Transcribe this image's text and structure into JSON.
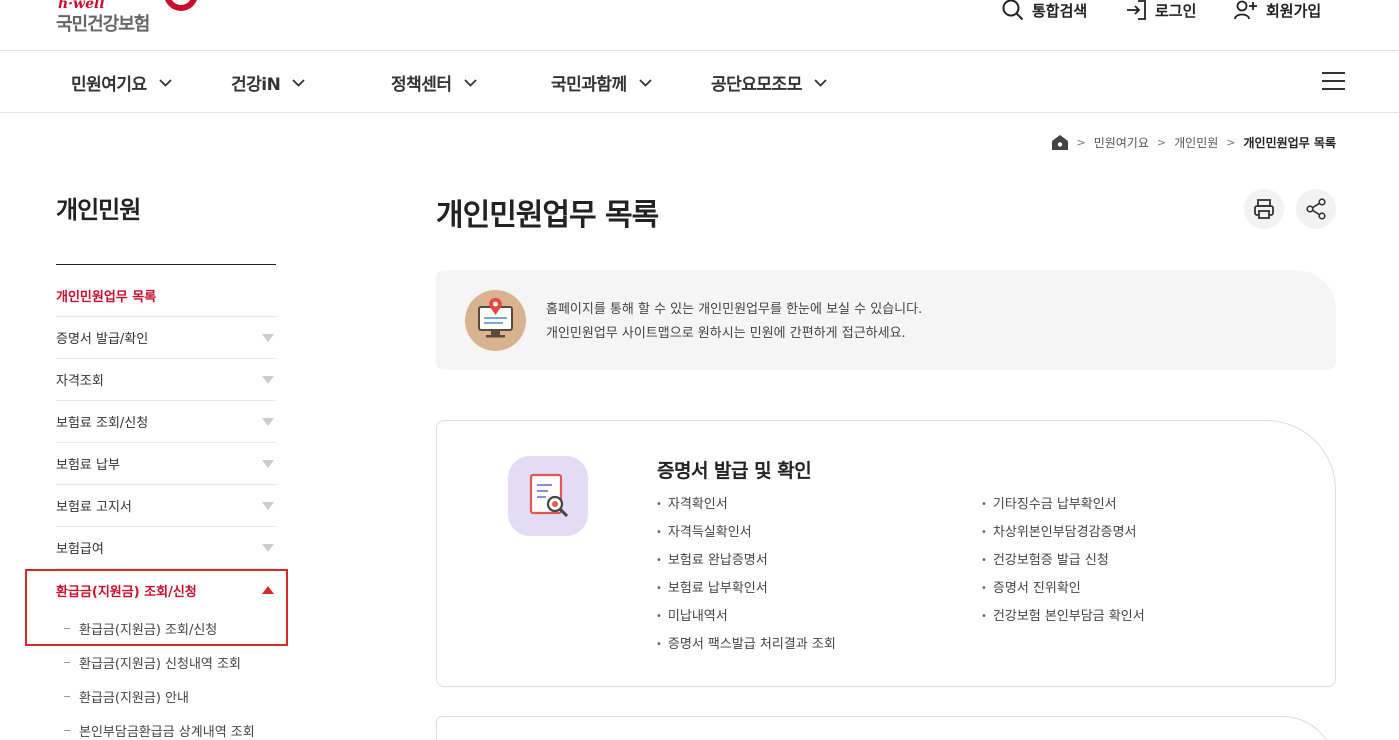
{
  "header": {
    "logo_small": "h·well",
    "logo_big": "국민건강보험",
    "search_label": "통합검색",
    "login_label": "로그인",
    "join_label": "회원가입"
  },
  "gnb": {
    "items": [
      {
        "label": "민원여기요"
      },
      {
        "label": "건강iN"
      },
      {
        "label": "정책센터"
      },
      {
        "label": "국민과함께"
      },
      {
        "label": "공단요모조모"
      }
    ]
  },
  "breadcrumb": {
    "items": [
      "민원여기요",
      "개인민원",
      "개인민원업무 목록"
    ]
  },
  "sidebar": {
    "title": "개인민원",
    "items": [
      {
        "label": "개인민원업무 목록"
      },
      {
        "label": "증명서 발급/확인"
      },
      {
        "label": "자격조회"
      },
      {
        "label": "보험료 조회/신청"
      },
      {
        "label": "보험료 납부"
      },
      {
        "label": "보험료 고지서"
      },
      {
        "label": "보험급여"
      },
      {
        "label": "환급금(지원금) 조회/신청"
      }
    ],
    "sub_items": [
      {
        "label": "환급금(지원금) 조회/신청"
      },
      {
        "label": "환급금(지원금) 신청내역 조회"
      },
      {
        "label": "환급금(지원금) 안내"
      },
      {
        "label": "본인부담금환급금 상계내역 조회"
      }
    ]
  },
  "main": {
    "title": "개인민원업무 목록",
    "intro_line1": "홈페이지를 통해 할 수 있는 개인민원업무를 한눈에 보실 수 있습니다.",
    "intro_line2": "개인민원업무 사이트맵으로 원하시는 민원에 간편하게 접근하세요.",
    "card": {
      "title": "증명서 발급 및 확인",
      "col1": [
        "자격확인서",
        "자격득실확인서",
        "보험료 완납증명서",
        "보험료 납부확인서",
        "미납내역서",
        "증명서 팩스발급 처리결과 조회"
      ],
      "col2": [
        "기타징수금 납부확인서",
        "차상위본인부담경감증명서",
        "건강보험증 발급 신청",
        "증명서 진위확인",
        "건강보험 본인부담금 확인서"
      ]
    }
  },
  "colors": {
    "brand_red": "#c8102e",
    "highlight_box": "#d42a2a",
    "card_icon_bg": "#e4dcf6",
    "intro_icon_bg": "#d9b28f"
  }
}
